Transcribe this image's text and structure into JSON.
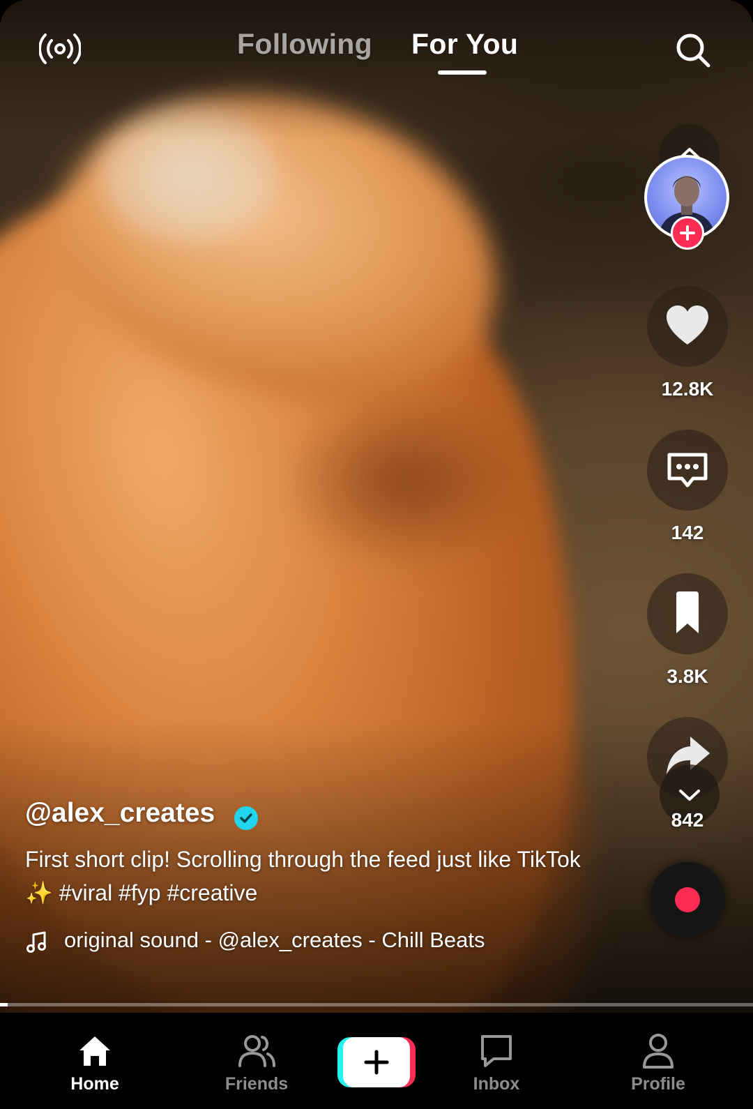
{
  "header": {
    "tabs": [
      {
        "label": "Following",
        "active": false
      },
      {
        "label": "For You",
        "active": true
      }
    ],
    "live_icon": "live-broadcast-icon",
    "search_icon": "search-icon"
  },
  "creator": {
    "username": "@alex_creates",
    "verified": true,
    "follow_icon": "plus-icon"
  },
  "actions": {
    "likes": "12.8K",
    "comments": "142",
    "bookmarks": "3.8K",
    "shares": "842"
  },
  "caption": {
    "text": "First short clip! Scrolling through the feed just like TikTok ✨ #viral #fyp #creative"
  },
  "sound": {
    "text": "original sound - @alex_creates - Chill Beats",
    "icon": "music-note-icon"
  },
  "playback": {
    "progress": 0.01
  },
  "nav": {
    "items": [
      {
        "label": "Home",
        "icon": "home-icon",
        "active": true
      },
      {
        "label": "Friends",
        "icon": "friends-icon",
        "active": false
      },
      {
        "label": "Inbox",
        "icon": "inbox-icon",
        "active": false
      },
      {
        "label": "Profile",
        "icon": "profile-icon",
        "active": false
      }
    ],
    "create_icon": "plus-icon"
  },
  "colors": {
    "accent_pink": "#fe2c55",
    "accent_cyan": "#25f4ee",
    "verified_blue": "#20d5ec"
  }
}
